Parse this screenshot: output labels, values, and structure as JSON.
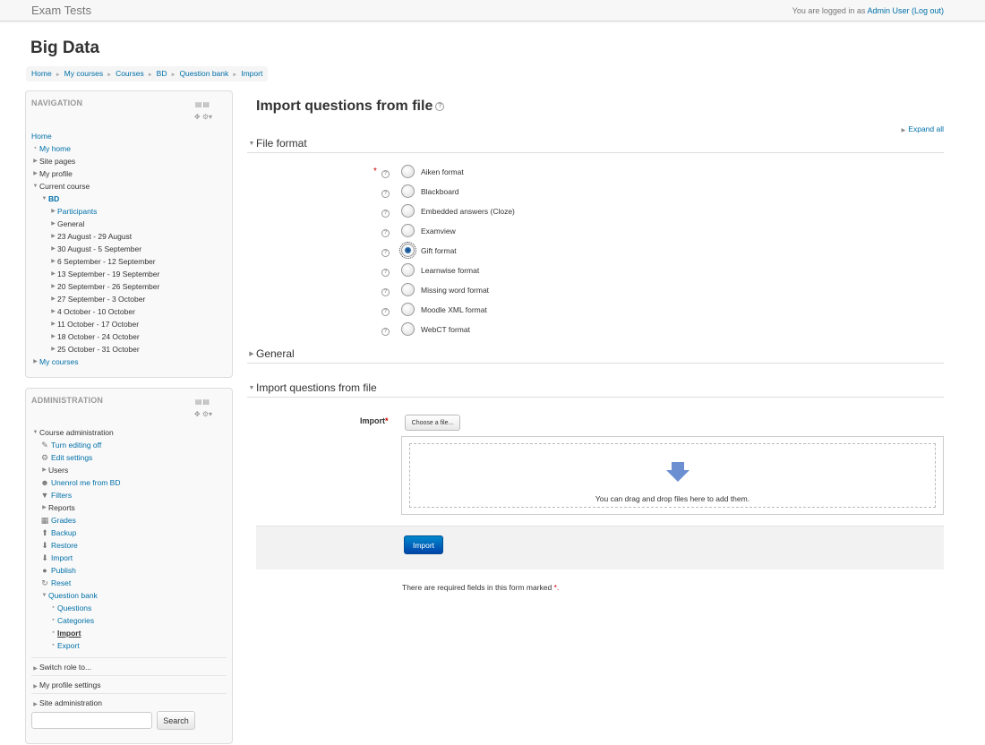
{
  "topbar": {
    "brand": "Exam Tests",
    "login_prefix": "You are logged in as",
    "user_name": "Admin User",
    "logout": "(Log out)"
  },
  "course_title": "Big Data",
  "breadcrumb": [
    "Home",
    "My courses",
    "Courses",
    "BD",
    "Question bank",
    "Import"
  ],
  "navigation": {
    "title": "NAVIGATION",
    "items": [
      {
        "label": "Home",
        "kind": "link",
        "indent": 0,
        "marker": "none"
      },
      {
        "label": "My home",
        "kind": "link",
        "indent": 0,
        "marker": "bullet"
      },
      {
        "label": "Site pages",
        "kind": "text",
        "indent": 0,
        "marker": "collapsed"
      },
      {
        "label": "My profile",
        "kind": "text",
        "indent": 0,
        "marker": "collapsed"
      },
      {
        "label": "Current course",
        "kind": "text",
        "indent": 0,
        "marker": "expanded"
      },
      {
        "label": "BD",
        "kind": "link-bold",
        "indent": 1,
        "marker": "expanded"
      },
      {
        "label": "Participants",
        "kind": "link",
        "indent": 2,
        "marker": "collapsed"
      },
      {
        "label": "General",
        "kind": "text",
        "indent": 2,
        "marker": "collapsed"
      },
      {
        "label": "23 August - 29 August",
        "kind": "text",
        "indent": 2,
        "marker": "collapsed"
      },
      {
        "label": "30 August - 5 September",
        "kind": "text",
        "indent": 2,
        "marker": "collapsed"
      },
      {
        "label": "6 September - 12 September",
        "kind": "text",
        "indent": 2,
        "marker": "collapsed"
      },
      {
        "label": "13 September - 19 September",
        "kind": "text",
        "indent": 2,
        "marker": "collapsed"
      },
      {
        "label": "20 September - 26 September",
        "kind": "text",
        "indent": 2,
        "marker": "collapsed"
      },
      {
        "label": "27 September - 3 October",
        "kind": "text",
        "indent": 2,
        "marker": "collapsed"
      },
      {
        "label": "4 October - 10 October",
        "kind": "text",
        "indent": 2,
        "marker": "collapsed"
      },
      {
        "label": "11 October - 17 October",
        "kind": "text",
        "indent": 2,
        "marker": "collapsed"
      },
      {
        "label": "18 October - 24 October",
        "kind": "text",
        "indent": 2,
        "marker": "collapsed"
      },
      {
        "label": "25 October - 31 October",
        "kind": "text",
        "indent": 2,
        "marker": "collapsed"
      },
      {
        "label": "My courses",
        "kind": "link",
        "indent": 0,
        "marker": "collapsed"
      }
    ]
  },
  "administration": {
    "title": "ADMINISTRATION",
    "items": [
      {
        "label": "Course administration",
        "kind": "text",
        "indent": 0,
        "marker": "expanded"
      },
      {
        "label": "Turn editing off",
        "kind": "link",
        "indent": 1,
        "marker": "icon",
        "icon": "pencil-icon"
      },
      {
        "label": "Edit settings",
        "kind": "link",
        "indent": 1,
        "marker": "icon",
        "icon": "gear-icon"
      },
      {
        "label": "Users",
        "kind": "text",
        "indent": 1,
        "marker": "collapsed"
      },
      {
        "label": "Unenrol me from BD",
        "kind": "link",
        "indent": 1,
        "marker": "icon",
        "icon": "user-icon"
      },
      {
        "label": "Filters",
        "kind": "link",
        "indent": 1,
        "marker": "icon",
        "icon": "filter-icon"
      },
      {
        "label": "Reports",
        "kind": "text",
        "indent": 1,
        "marker": "collapsed"
      },
      {
        "label": "Grades",
        "kind": "link",
        "indent": 1,
        "marker": "icon",
        "icon": "grades-icon"
      },
      {
        "label": "Backup",
        "kind": "link",
        "indent": 1,
        "marker": "icon",
        "icon": "backup-icon"
      },
      {
        "label": "Restore",
        "kind": "link",
        "indent": 1,
        "marker": "icon",
        "icon": "restore-icon"
      },
      {
        "label": "Import",
        "kind": "link",
        "indent": 1,
        "marker": "icon",
        "icon": "import-icon"
      },
      {
        "label": "Publish",
        "kind": "link",
        "indent": 1,
        "marker": "icon",
        "icon": "globe-icon"
      },
      {
        "label": "Reset",
        "kind": "link",
        "indent": 1,
        "marker": "icon",
        "icon": "reset-icon"
      },
      {
        "label": "Question bank",
        "kind": "link",
        "indent": 1,
        "marker": "expanded"
      },
      {
        "label": "Questions",
        "kind": "link",
        "indent": 2,
        "marker": "bullet"
      },
      {
        "label": "Categories",
        "kind": "link",
        "indent": 2,
        "marker": "bullet"
      },
      {
        "label": "Import",
        "kind": "current",
        "indent": 2,
        "marker": "bullet"
      },
      {
        "label": "Export",
        "kind": "link",
        "indent": 2,
        "marker": "bullet"
      }
    ],
    "sections": [
      "Switch role to...",
      "My profile settings",
      "Site administration"
    ],
    "search_button": "Search",
    "search_value": ""
  },
  "main": {
    "heading": "Import questions from file",
    "expand_all": "Expand all",
    "sections": {
      "file_format": "File format",
      "general": "General",
      "import_file": "Import questions from file"
    },
    "formats": [
      {
        "label": "Aiken format",
        "checked": false,
        "required": true
      },
      {
        "label": "Blackboard",
        "checked": false,
        "required": false
      },
      {
        "label": "Embedded answers (Cloze)",
        "checked": false,
        "required": false
      },
      {
        "label": "Examview",
        "checked": false,
        "required": false
      },
      {
        "label": "Gift format",
        "checked": true,
        "required": false
      },
      {
        "label": "Learnwise format",
        "checked": false,
        "required": false
      },
      {
        "label": "Missing word format",
        "checked": false,
        "required": false
      },
      {
        "label": "Moodle XML format",
        "checked": false,
        "required": false
      },
      {
        "label": "WebCT format",
        "checked": false,
        "required": false
      }
    ],
    "import_label": "Import",
    "required_star": "*",
    "choose_file": "Choose a file...",
    "drop_text": "You can drag and drop files here to add them.",
    "import_button": "Import",
    "required_note": "There are required fields in this form marked",
    "required_note_star": "*."
  },
  "colors": {
    "link": "#0070a8",
    "required": "#cc0000",
    "primary_button": "#0055b3"
  }
}
